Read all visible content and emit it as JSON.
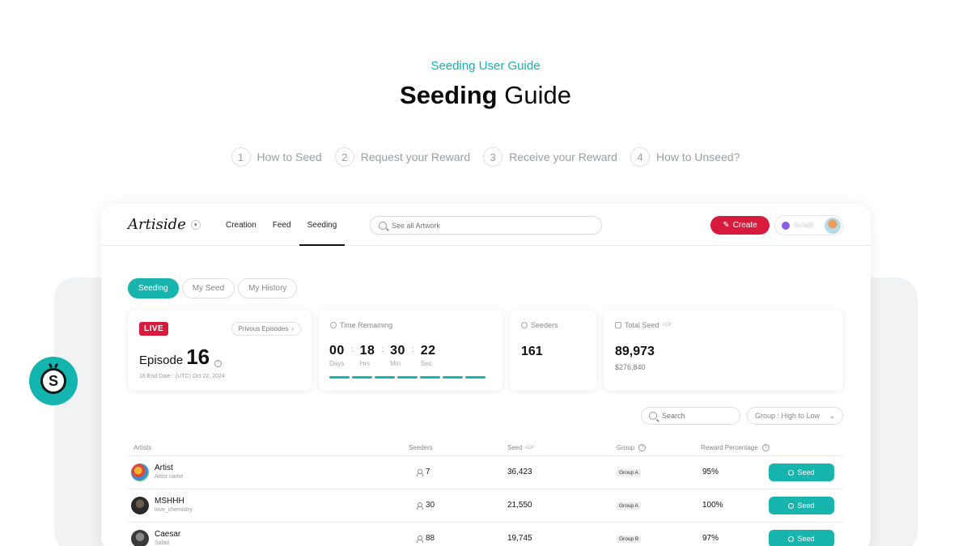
{
  "header": {
    "eyebrow": "Seeding User Guide",
    "title_bold": "Seeding",
    "title_rest": "Guide"
  },
  "steps": [
    {
      "num": "1",
      "label": "How to Seed"
    },
    {
      "num": "2",
      "label": "Request your Reward"
    },
    {
      "num": "3",
      "label": "Receive your Reward"
    },
    {
      "num": "4",
      "label": "How to Unseed?"
    }
  ],
  "colors": {
    "accent": "#17b5ad",
    "brand_red": "#d81b3c"
  },
  "app": {
    "brand": "Artiside",
    "nav": [
      "Creation",
      "Feed",
      "Seeding"
    ],
    "nav_active": "Seeding",
    "search_placeholder": "See all Artwork",
    "create_label": "Create",
    "user_name": "0x7a3f",
    "tabs": [
      "Seeding",
      "My Seed",
      "My History"
    ],
    "tab_active": "Seeding",
    "episode": {
      "live": "LIVE",
      "previous": "Privous Episodes",
      "word": "Episode",
      "number": "16",
      "end_date": "16 End Date : (UTC) Oct 22, 2024"
    },
    "time_remaining": {
      "label": "Time Remaining",
      "days": "00",
      "hrs": "18",
      "min": "30",
      "sec": "22",
      "days_label": "Days",
      "hrs_label": "Hrs",
      "min_label": "Min",
      "sec_label": "Sec"
    },
    "seeders": {
      "label": "Seeders",
      "value": "161"
    },
    "total_seed": {
      "label": "Total Seed",
      "unit": "ADF",
      "value": "89,973",
      "usd": "$276,840"
    },
    "filter_search_placeholder": "Search",
    "group_select": "Group : High to Low",
    "table": {
      "headers": {
        "artists": "Artists",
        "seeders": "Seeders",
        "seed": "Seed",
        "seed_unit": "ADF",
        "group": "Group",
        "reward": "Reward Percentage"
      },
      "seed_label": "Seed",
      "rows": [
        {
          "name": "Artist",
          "sub": "Artist name",
          "seeders": "7",
          "seed": "36,423",
          "group": "Group A",
          "pct": "95%"
        },
        {
          "name": "MSHHH",
          "sub": "love_chemistry",
          "seeders": "30",
          "seed": "21,550",
          "group": "Group A",
          "pct": "100%"
        },
        {
          "name": "Caesar",
          "sub": "Salad",
          "seeders": "88",
          "seed": "19,745",
          "group": "Group B",
          "pct": "97%"
        }
      ]
    }
  }
}
